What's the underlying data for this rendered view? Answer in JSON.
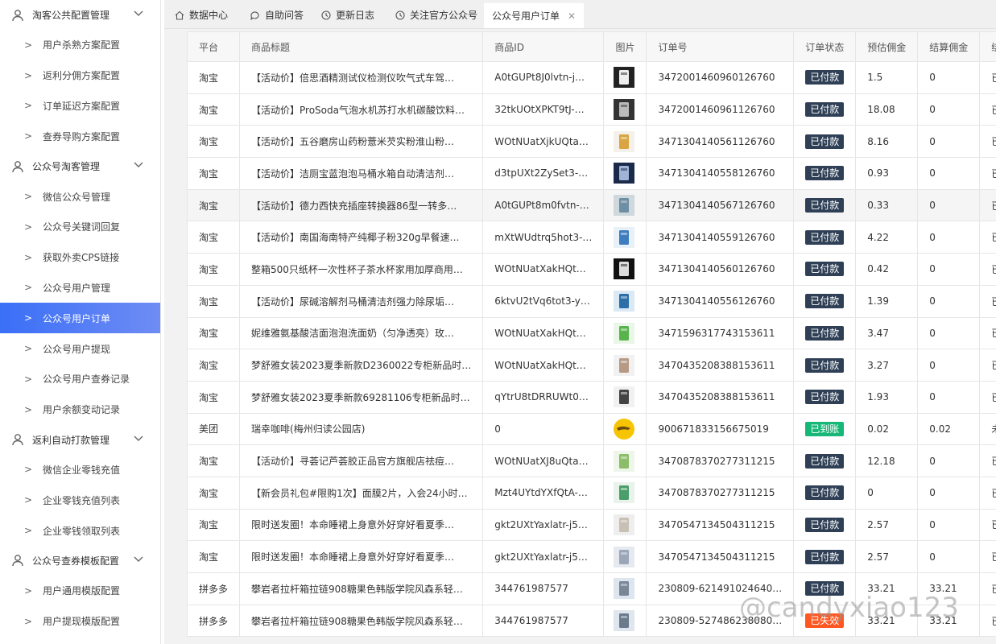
{
  "sidebar": {
    "items": [
      {
        "type": "group",
        "label": "淘客公共配置管理"
      },
      {
        "type": "item",
        "label": "用户杀熟方案配置"
      },
      {
        "type": "item",
        "label": "返利分佣方案配置"
      },
      {
        "type": "item",
        "label": "订单延迟方案配置"
      },
      {
        "type": "item",
        "label": "查券导购方案配置"
      },
      {
        "type": "group",
        "label": "公众号淘客管理"
      },
      {
        "type": "item",
        "label": "微信公众号管理"
      },
      {
        "type": "item",
        "label": "公众号关键词回复"
      },
      {
        "type": "item",
        "label": "获取外卖CPS链接"
      },
      {
        "type": "item",
        "label": "公众号用户管理"
      },
      {
        "type": "item",
        "label": "公众号用户订单",
        "active": true
      },
      {
        "type": "item",
        "label": "公众号用户提现"
      },
      {
        "type": "item",
        "label": "公众号用户查券记录"
      },
      {
        "type": "item",
        "label": "用户余额变动记录"
      },
      {
        "type": "group",
        "label": "返利自动打款管理"
      },
      {
        "type": "item",
        "label": "微信企业零钱充值"
      },
      {
        "type": "item",
        "label": "企业零钱充值列表"
      },
      {
        "type": "item",
        "label": "企业零钱领取列表"
      },
      {
        "type": "group",
        "label": "公众号查券模板配置"
      },
      {
        "type": "item",
        "label": "用户通用模版配置"
      },
      {
        "type": "item",
        "label": "用户提现模版配置"
      }
    ]
  },
  "tabs": [
    {
      "label": "数据中心",
      "icon": "home-icon"
    },
    {
      "label": "自助问答",
      "icon": "question-icon"
    },
    {
      "label": "更新日志",
      "icon": "clock-icon"
    },
    {
      "label": "关注官方公众号",
      "icon": "clock-icon"
    },
    {
      "label": "公众号用户订单",
      "active": true
    }
  ],
  "table": {
    "headers": [
      "平台",
      "商品标题",
      "商品ID",
      "图片",
      "订单号",
      "订单状态",
      "预估佣金",
      "结算佣金",
      "绑定状态"
    ],
    "rows": [
      {
        "platform": "淘宝",
        "title": "【活动价】倍思酒精测试仪检测仪吹气式车驾…",
        "id": "A0tGUPt8J0lvtn-j…",
        "order": "3472001460960126760",
        "status": "已付款",
        "est": "1.5",
        "settle": "0",
        "bind": "已绑定"
      },
      {
        "platform": "淘宝",
        "title": "【活动价】ProSoda气泡水机苏打水机碳酸饮料…",
        "id": "32tkUOtXPKT9tJ-…",
        "order": "3472001460961126760",
        "status": "已付款",
        "est": "18.08",
        "settle": "0",
        "bind": "已绑定"
      },
      {
        "platform": "淘宝",
        "title": "【活动价】五谷磨房山药粉薏米芡实粉淮山粉…",
        "id": "WOtNUatXjkUQta…",
        "order": "3471304140561126760",
        "status": "已付款",
        "est": "8.16",
        "settle": "0",
        "bind": "已绑定"
      },
      {
        "platform": "淘宝",
        "title": "【活动价】洁厕宝蓝泡泡马桶水箱自动清洁剂…",
        "id": "d3tpUXt2ZySet3-…",
        "order": "3471304140558126760",
        "status": "已付款",
        "est": "0.93",
        "settle": "0",
        "bind": "已绑定"
      },
      {
        "platform": "淘宝",
        "title": "【活动价】德力西快充插座转换器86型一转多…",
        "id": "A0tGUPt8m0fvtn-…",
        "order": "3471304140567126760",
        "status": "已付款",
        "est": "0.33",
        "settle": "0",
        "bind": "已绑定",
        "highlight": true
      },
      {
        "platform": "淘宝",
        "title": "【活动价】南国海南特产纯椰子粉320g早餐速…",
        "id": "mXtWUdtrq5hot3-…",
        "order": "3471304140559126760",
        "status": "已付款",
        "est": "4.22",
        "settle": "0",
        "bind": "已绑定"
      },
      {
        "platform": "淘宝",
        "title": "整箱500只纸杯一次性杯子茶水杯家用加厚商用…",
        "id": "WOtNUatXakHQt…",
        "order": "3471304140560126760",
        "status": "已付款",
        "est": "0.42",
        "settle": "0",
        "bind": "已绑定"
      },
      {
        "platform": "淘宝",
        "title": "【活动价】尿碱溶解剂马桶清洁剂强力除尿垢…",
        "id": "6ktvU2tVq6tot3-y…",
        "order": "3471304140556126760",
        "status": "已付款",
        "est": "1.39",
        "settle": "0",
        "bind": "已绑定"
      },
      {
        "platform": "淘宝",
        "title": "妮维雅氨基酸洁面泡泡洗面奶（匀净透亮）玫…",
        "id": "WOtNUatXakHQt…",
        "order": "3471596317743153611",
        "status": "已付款",
        "est": "3.47",
        "settle": "0",
        "bind": "已绑定"
      },
      {
        "platform": "淘宝",
        "title": "梦舒雅女装2023夏季新款D2360022专柜新品时…",
        "id": "WOtNUatXakHQt…",
        "order": "3470435208388153611",
        "status": "已付款",
        "est": "3.27",
        "settle": "0",
        "bind": "已绑定"
      },
      {
        "platform": "淘宝",
        "title": "梦舒雅女装2023夏季新款69281106专柜新品时…",
        "id": "qYtrU8tDRRUWt0…",
        "order": "3470435208388153611",
        "status": "已付款",
        "est": "1.93",
        "settle": "0",
        "bind": "已绑定"
      },
      {
        "platform": "美团",
        "title": "瑞幸咖啡(梅州归读公园店)",
        "id": "0",
        "order": "900671833156675019",
        "status": "已到账",
        "est": "0.02",
        "settle": "0.02",
        "bind": "未绑定"
      },
      {
        "platform": "淘宝",
        "title": "【活动价】寻荟记芦荟胶正品官方旗舰店祛痘…",
        "id": "WOtNUatXJ8uQta…",
        "order": "3470878370277311215",
        "status": "已付款",
        "est": "12.18",
        "settle": "0",
        "bind": "已绑定"
      },
      {
        "platform": "淘宝",
        "title": "【新会员礼包#限购1次】面膜2片，入会24小时…",
        "id": "Mzt4UYtdYXfQtA-…",
        "order": "3470878370277311215",
        "status": "已付款",
        "est": "0",
        "settle": "0",
        "bind": "已绑定"
      },
      {
        "platform": "淘宝",
        "title": "限时送发圈！本命睡裙上身意外好穿好看夏季…",
        "id": "gkt2UXtYaxlatr-j5…",
        "order": "3470547134504311215",
        "status": "已付款",
        "est": "2.57",
        "settle": "0",
        "bind": "已绑定"
      },
      {
        "platform": "淘宝",
        "title": "限时送发圈！本命睡裙上身意外好穿好看夏季…",
        "id": "gkt2UXtYaxlatr-j5…",
        "order": "3470547134504311215",
        "status": "已付款",
        "est": "2.57",
        "settle": "0",
        "bind": "已绑定"
      },
      {
        "platform": "拼多多",
        "title": "攀岩者拉杆箱拉链908糖果色韩版学院风森系轻…",
        "id": "344761987577",
        "order": "230809-621491024640…",
        "status": "已付款",
        "est": "33.21",
        "settle": "33.21",
        "bind": "已绑定"
      },
      {
        "platform": "拼多多",
        "title": "攀岩者拉杆箱拉链908糖果色韩版学院风森系轻…",
        "id": "344761987577",
        "order": "230809-527486238080…",
        "status": "已失效",
        "est": "33.21",
        "settle": "33.21",
        "bind": "已绑定"
      }
    ]
  },
  "colors": {
    "badge_paid": "#2f4056",
    "badge_arrived": "#16b777",
    "badge_invalid": "#ff5722",
    "active_menu": "#3a6ff7"
  },
  "watermark": "@candyxiao123"
}
